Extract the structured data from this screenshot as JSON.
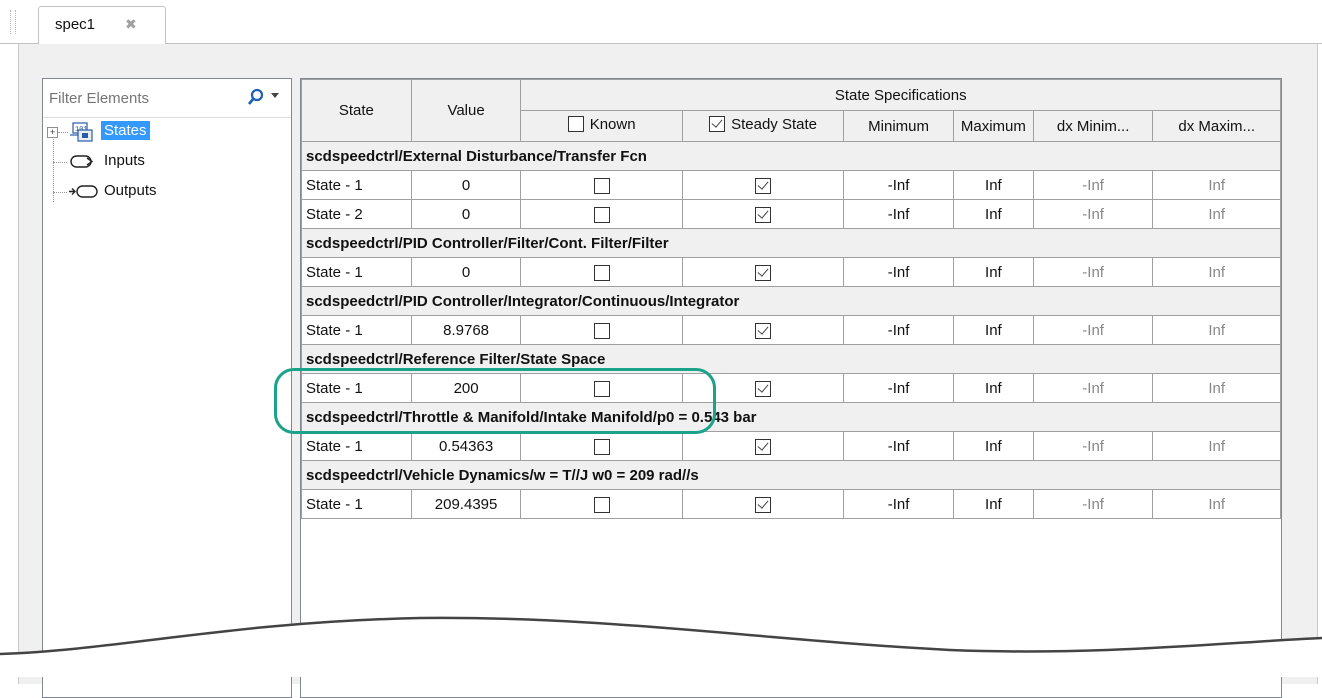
{
  "tab": {
    "title": "spec1",
    "close_glyph": "✖"
  },
  "filter": {
    "placeholder": "Filter Elements"
  },
  "tree": {
    "items": [
      {
        "label": "States",
        "selected": true
      },
      {
        "label": "Inputs",
        "selected": false
      },
      {
        "label": "Outputs",
        "selected": false
      }
    ]
  },
  "table": {
    "headers": {
      "state": "State",
      "value": "Value",
      "group": "State Specifications",
      "known": "Known",
      "steady": "Steady State",
      "minimum": "Minimum",
      "maximum": "Maximum",
      "dx_min": "dx Minim...",
      "dx_max": "dx Maxim..."
    },
    "groups": [
      {
        "name": "scdspeedctrl/External Disturbance/Transfer Fcn",
        "rows": [
          {
            "state": "State - 1",
            "value": "0",
            "known": false,
            "steady": true,
            "min": "-Inf",
            "max": "Inf",
            "dxmin": "-Inf",
            "dxmax": "Inf"
          },
          {
            "state": "State - 2",
            "value": "0",
            "known": false,
            "steady": true,
            "min": "-Inf",
            "max": "Inf",
            "dxmin": "-Inf",
            "dxmax": "Inf"
          }
        ]
      },
      {
        "name": "scdspeedctrl/PID Controller/Filter/Cont. Filter/Filter",
        "rows": [
          {
            "state": "State - 1",
            "value": "0",
            "known": false,
            "steady": true,
            "min": "-Inf",
            "max": "Inf",
            "dxmin": "-Inf",
            "dxmax": "Inf"
          }
        ]
      },
      {
        "name": "scdspeedctrl/PID Controller/Integrator/Continuous/Integrator",
        "rows": [
          {
            "state": "State - 1",
            "value": "8.9768",
            "known": false,
            "steady": true,
            "min": "-Inf",
            "max": "Inf",
            "dxmin": "-Inf",
            "dxmax": "Inf"
          }
        ]
      },
      {
        "name": "scdspeedctrl/Reference Filter/State Space",
        "rows": [
          {
            "state": "State - 1",
            "value": "200",
            "known": false,
            "steady": true,
            "min": "-Inf",
            "max": "Inf",
            "dxmin": "-Inf",
            "dxmax": "Inf"
          }
        ]
      },
      {
        "name": "scdspeedctrl/Throttle & Manifold/Intake Manifold/p0 = 0.543 bar",
        "rows": [
          {
            "state": "State - 1",
            "value": "0.54363",
            "known": false,
            "steady": true,
            "min": "-Inf",
            "max": "Inf",
            "dxmin": "-Inf",
            "dxmax": "Inf"
          }
        ]
      },
      {
        "name": "scdspeedctrl/Vehicle Dynamics/w = T//J w0 = 209 rad//s",
        "rows": [
          {
            "state": "State - 1",
            "value": "209.4395",
            "known": false,
            "steady": true,
            "min": "-Inf",
            "max": "Inf",
            "dxmin": "-Inf",
            "dxmax": "Inf"
          }
        ]
      }
    ]
  },
  "colors": {
    "highlight": "#1aa389",
    "selection": "#3399ff",
    "header_bg": "#f0f0f0"
  }
}
